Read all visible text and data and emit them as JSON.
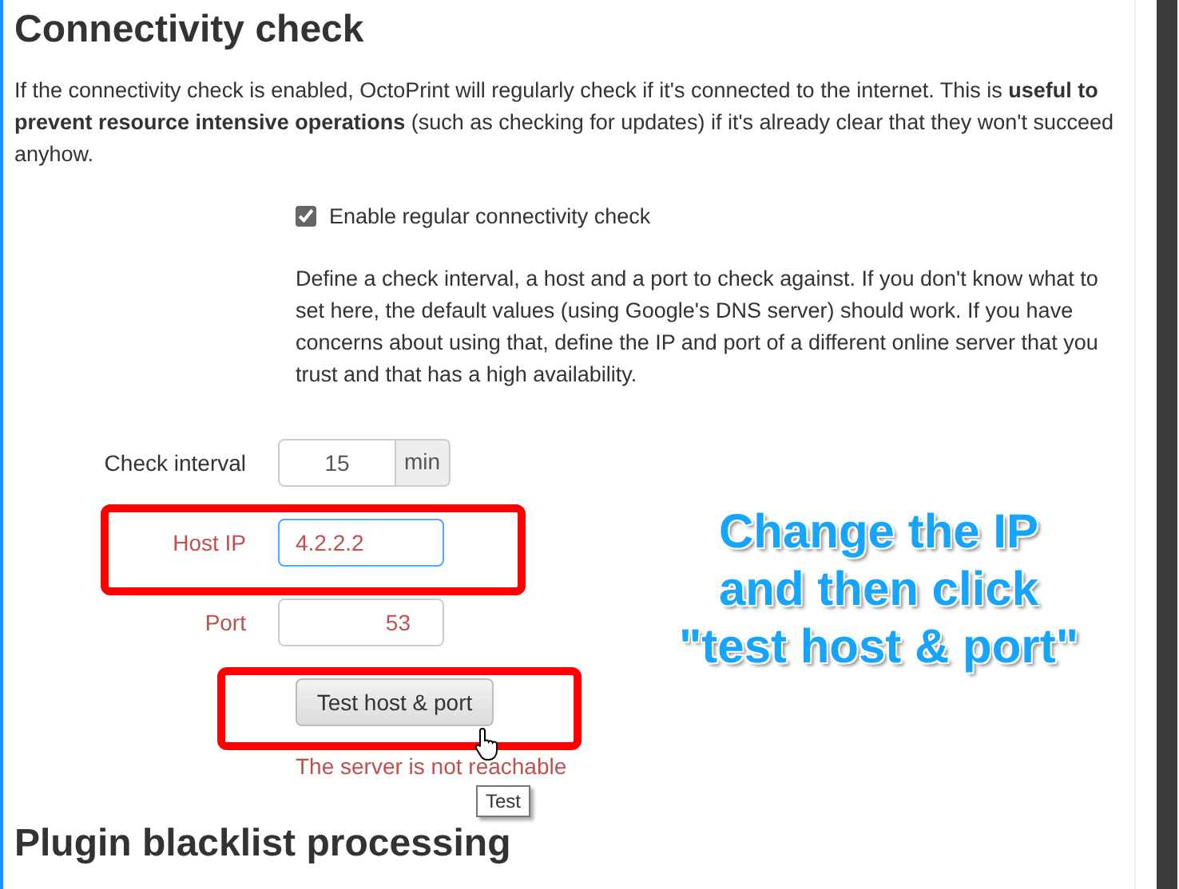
{
  "section": {
    "title": "Connectivity check",
    "intro": "If the connectivity check is enabled, OctoPrint will regularly check if it's connected to the internet. This is **useful to prevent resource intensive operations** (such as checking for updates) if it's already clear that they won't succeed anyhow.",
    "checkbox": {
      "label": "Enable regular connectivity check",
      "checked": true
    },
    "description": "Define a check interval, a host and a port to check against. If you don't know what to set here, the default values (using Google's DNS server) should work. If you have concerns about using that, define the IP and port of a different online server that you trust and that has a high availability.",
    "fields": [
      {
        "label": "Check interval",
        "value": "15",
        "unit": "min",
        "kind": "number",
        "invalid": false,
        "focused": false
      },
      {
        "label": "Host IP",
        "value": "4.2.2.2",
        "kind": "text",
        "invalid": true,
        "focused": true
      },
      {
        "label": "Port",
        "value": "53",
        "kind": "number",
        "invalid": true,
        "focused": false
      }
    ],
    "button": "Test host & port",
    "error": "The server is not reachable",
    "tooltip": "Test"
  },
  "annotation": {
    "lines": [
      "Change the IP",
      "and then click",
      "\"test host & port\""
    ]
  },
  "next_section": {
    "title": "Plugin blacklist processing"
  }
}
